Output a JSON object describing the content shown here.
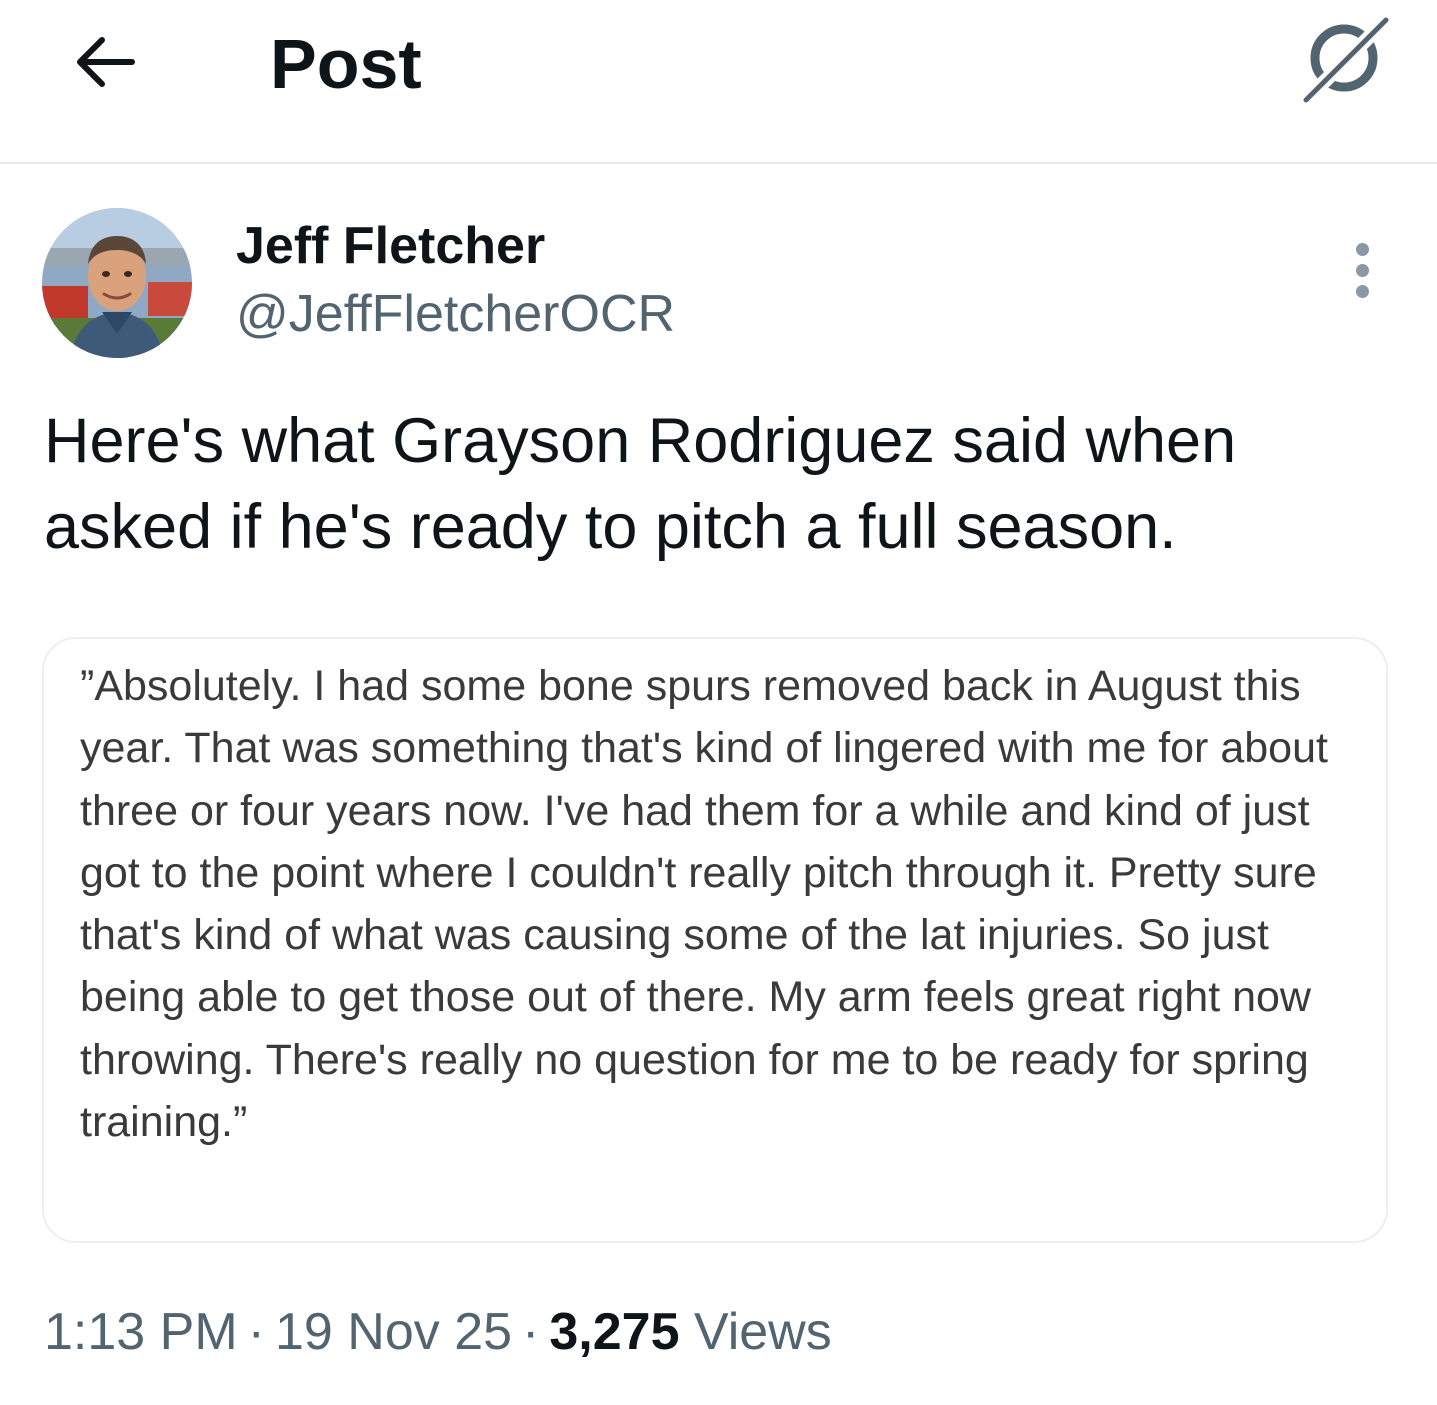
{
  "header": {
    "title": "Post",
    "back_icon": "arrow-left-icon",
    "grok_icon": "grok-icon"
  },
  "author": {
    "name": "Jeff Fletcher",
    "handle": "@JeffFletcherOCR",
    "more_icon": "more-vertical-icon"
  },
  "post": {
    "text": "Here's what Grayson Rodriguez said when asked if he's ready to pitch a full season."
  },
  "quote_image": {
    "text": "”Absolutely. I had some bone spurs removed back in August this year. That was something that's kind of lingered with me for about three or four years now. I've had them for a while and kind of just got to the point where I couldn't really pitch through it. Pretty sure that's kind of what was causing some of the lat injuries. So just being able to get those out of there. My arm feels great right now throwing. There's really no question for me to be ready for spring training.”"
  },
  "meta": {
    "time": "1:13 PM",
    "separator": "·",
    "date": "19 Nov 25",
    "views_count": "3,275",
    "views_label": "Views"
  },
  "colors": {
    "text_primary": "#0f1419",
    "text_secondary": "#536471",
    "divider": "#e6e9ec",
    "quote_text": "#3a3a3a"
  }
}
